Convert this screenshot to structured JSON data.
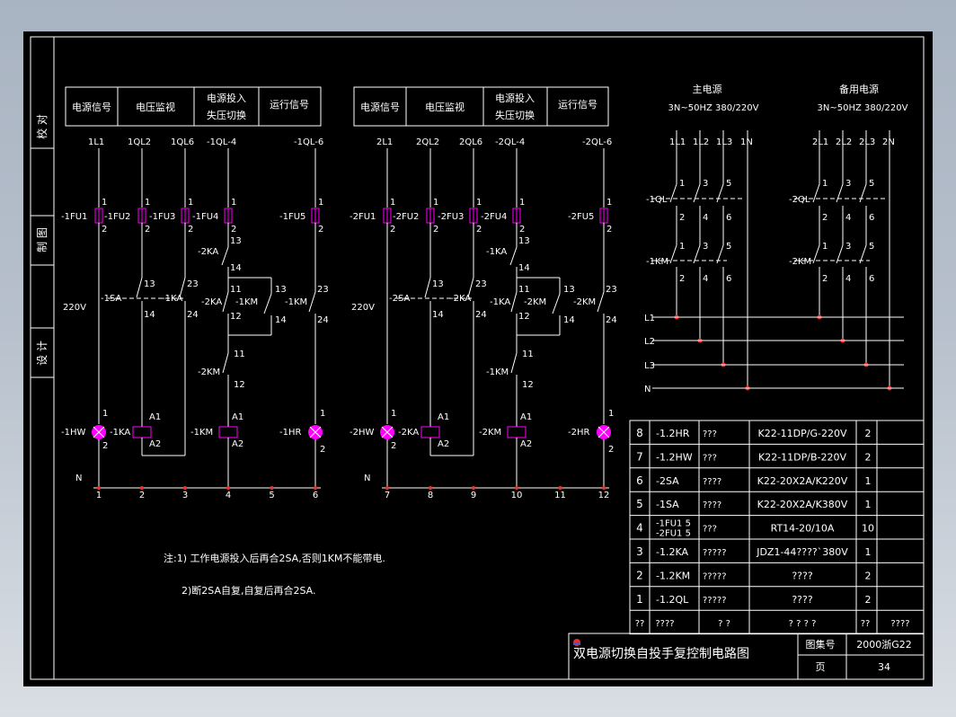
{
  "side_labels": [
    "校 对",
    "制 图",
    "设 计"
  ],
  "header_left": [
    "电源信号",
    "电压监视",
    "电源投入",
    "失压切换",
    "运行信号"
  ],
  "header_right": [
    "电源信号",
    "电压监视",
    "电源投入",
    "失压切换",
    "运行信号"
  ],
  "left": {
    "top_terms": [
      "1L1",
      "1QL2",
      "1QL6",
      "-1QL-4",
      "-1QL-6"
    ],
    "fuses": [
      "-1FU1",
      "-1FU2",
      "-1FU3",
      "-1FU4",
      "-1FU5"
    ],
    "volt": "220V",
    "ka_contact": "-1KA",
    "sa": "-1SA",
    "ka": "-2KA",
    "km_a": "-1KM",
    "km_b": "-1KM",
    "km_c": "-2KM",
    "lamp_l": "-1HW",
    "coil_ka": "-1KA",
    "coil_km": "-1KM",
    "lamp_r": "-1HR",
    "coil_a1": "A1",
    "coil_a2": "A2",
    "neutral": "N",
    "nodes": [
      "1",
      "2",
      "3",
      "4",
      "5",
      "6"
    ]
  },
  "right": {
    "top_terms": [
      "2L1",
      "2QL2",
      "2QL6",
      "-2QL-4",
      "-2QL-6"
    ],
    "fuses": [
      "-2FU1",
      "-2FU2",
      "-2FU3",
      "-2FU4",
      "-2FU5"
    ],
    "volt": "220V",
    "ka_contact": "-2KA",
    "sa": "-2SA",
    "ka": "-1KA",
    "km_a": "-2KM",
    "km_b": "-2KM",
    "km_c": "-1KM",
    "lamp_l": "-2HW",
    "coil_ka": "-2KA",
    "coil_km": "-2KM",
    "lamp_r": "-2HR",
    "coil_a1": "A1",
    "coil_a2": "A2",
    "neutral": "N",
    "nodes": [
      "7",
      "8",
      "9",
      "10",
      "11",
      "12"
    ]
  },
  "pin_labels": {
    "p1": "1",
    "p2": "2",
    "p3": "3",
    "p4": "4",
    "p5": "5",
    "p6": "6",
    "p11": "11",
    "p12": "12",
    "p13": "13",
    "p14": "14",
    "p23": "23",
    "p24": "24"
  },
  "main_power": {
    "title": "主电源",
    "spec": "3N~50HZ 380/220V",
    "terms": [
      "1L1",
      "1L2",
      "1L3",
      "1N"
    ],
    "breaker": "-1QL",
    "contactor": "-1KM"
  },
  "backup_power": {
    "title": "备用电源",
    "spec": "3N~50HZ 380/220V",
    "terms": [
      "2L1",
      "2L2",
      "2L3",
      "2N"
    ],
    "breaker": "-2QL",
    "contactor": "-2KM"
  },
  "buses": [
    "L1",
    "L2",
    "L3",
    "N"
  ],
  "notes": [
    "注:1) 工作电源投入后再合2SA,否则1KM不能带电.",
    "2)断2SA自复,自复后再合2SA."
  ],
  "bom": [
    {
      "no": "8",
      "code": "-1.2HR",
      "name": "???",
      "model": "K22-11DP/G-220V",
      "qty": "2"
    },
    {
      "no": "7",
      "code": "-1.2HW",
      "name": "???",
      "model": "K22-11DP/B-220V",
      "qty": "2"
    },
    {
      "no": "6",
      "code": "-2SA",
      "name": "????",
      "model": "K22-20X2A/K220V",
      "qty": "1"
    },
    {
      "no": "5",
      "code": "-1SA",
      "name": "????",
      "model": "K22-20X2A/K380V",
      "qty": "1"
    },
    {
      "no": "4",
      "code": "-1FU1 5",
      "code2": "-2FU1 5",
      "name": "???",
      "model": "RT14-20/10A",
      "qty": "10"
    },
    {
      "no": "3",
      "code": "-1.2KA",
      "name": "?????",
      "model": "JDZ1-44????`380V",
      "qty": "1"
    },
    {
      "no": "2",
      "code": "-1.2KM",
      "name": "?????",
      "model": "????",
      "qty": "2"
    },
    {
      "no": "1",
      "code": "-1.2QL",
      "name": "?????",
      "model": "????",
      "qty": "2"
    }
  ],
  "bom_header": [
    "??",
    "????",
    "? ?",
    "? ? ? ?",
    "??",
    "????"
  ],
  "title_block": {
    "title": "双电源切换自投手复控制电路图",
    "set_label": "图集号",
    "set_no": "2000浙G22",
    "page_label": "页",
    "page_no": "34"
  }
}
